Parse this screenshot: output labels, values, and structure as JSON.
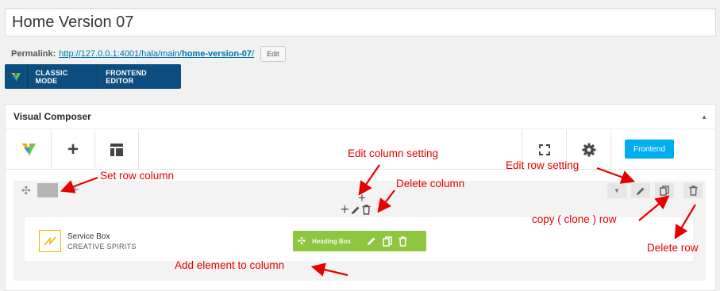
{
  "post": {
    "title": "Home Version 07",
    "permalink_label": "Permalink:",
    "permalink_base": "http://127.0.0.1:4001/hala/main/",
    "permalink_slug": "home-version-07",
    "permalink_end": "/",
    "edit_label": "Edit"
  },
  "modes": {
    "classic": "CLASSIC MODE",
    "frontend": "FRONTEND EDITOR"
  },
  "composer": {
    "title": "Visual Composer",
    "frontend_button": "Frontend"
  },
  "element": {
    "service_title": "Service Box",
    "service_subtitle": "CREATIVE SPIRITS",
    "heading_label": "Heading Box"
  },
  "annotations": {
    "set_row_column": "Set row column",
    "edit_column_setting": "Edit column setting",
    "delete_column": "Delete column",
    "edit_row_setting": "Edit row setting",
    "copy_row": "copy ( clone ) row",
    "delete_row": "Delete row",
    "add_element": "Add element to column"
  },
  "colors": {
    "annotation": "#e60000",
    "brand": "#0d4e80",
    "accent": "#00aeef",
    "element_green": "#8ec73f"
  }
}
